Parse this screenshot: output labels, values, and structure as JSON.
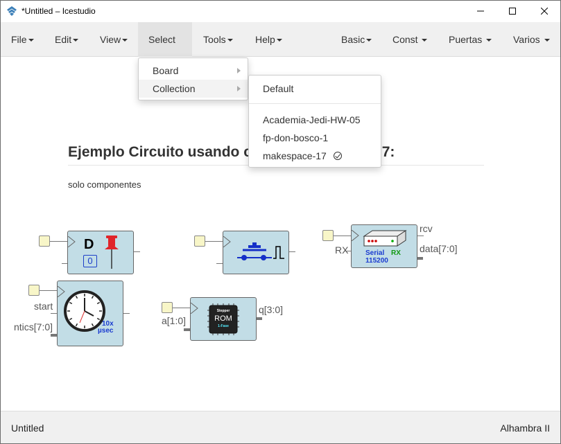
{
  "window": {
    "title": "*Untitled – Icestudio",
    "minimize_glyph": "—",
    "maximize_glyph": "☐",
    "close_glyph": "✕"
  },
  "menubar": {
    "left": [
      {
        "label": "File"
      },
      {
        "label": "Edit"
      },
      {
        "label": "View"
      },
      {
        "label": "Select"
      },
      {
        "label": "Tools"
      },
      {
        "label": "Help"
      }
    ],
    "right": [
      {
        "label": "Basic"
      },
      {
        "label": "Const"
      },
      {
        "label": "Puertas"
      },
      {
        "label": "Varios"
      }
    ],
    "active": "Select"
  },
  "select_menu": {
    "items": [
      {
        "label": "Board"
      },
      {
        "label": "Collection"
      }
    ]
  },
  "collection_menu": {
    "default_label": "Default",
    "items": [
      {
        "label": "Academia-Jedi-HW-05"
      },
      {
        "label": "fp-don-bosco-1"
      },
      {
        "label": "makespace-17",
        "selected": true
      }
    ]
  },
  "canvas": {
    "info_title_left": "Ejemplo Circuito usando co",
    "info_title_right": "7:",
    "info_subtitle": "solo componentes",
    "blocks": {
      "dff": {
        "letter": "D",
        "value": "0"
      },
      "button": {},
      "serial": {
        "in_label": "RX",
        "out_rcv": "rcv",
        "out_data": "data[7:0]",
        "text1": "Serial",
        "text2": "RX",
        "text3": "115200"
      },
      "timer": {
        "in_start": "start",
        "in_ntics": "ntics[7:0]",
        "multiplier": "10x",
        "unit": "µsec"
      },
      "rom": {
        "in_addr": "a[1:0]",
        "out_q": "q[3:0]",
        "chip_top": "Stepper",
        "chip_mid": "ROM",
        "chip_bot": "1-Fase"
      }
    }
  },
  "statusbar": {
    "left": "Untitled",
    "right": "Alhambra II"
  },
  "colors": {
    "block_fill": "#c2dde6",
    "port_fill": "#f8f6c8",
    "menubar_bg": "#f0f0f0"
  }
}
